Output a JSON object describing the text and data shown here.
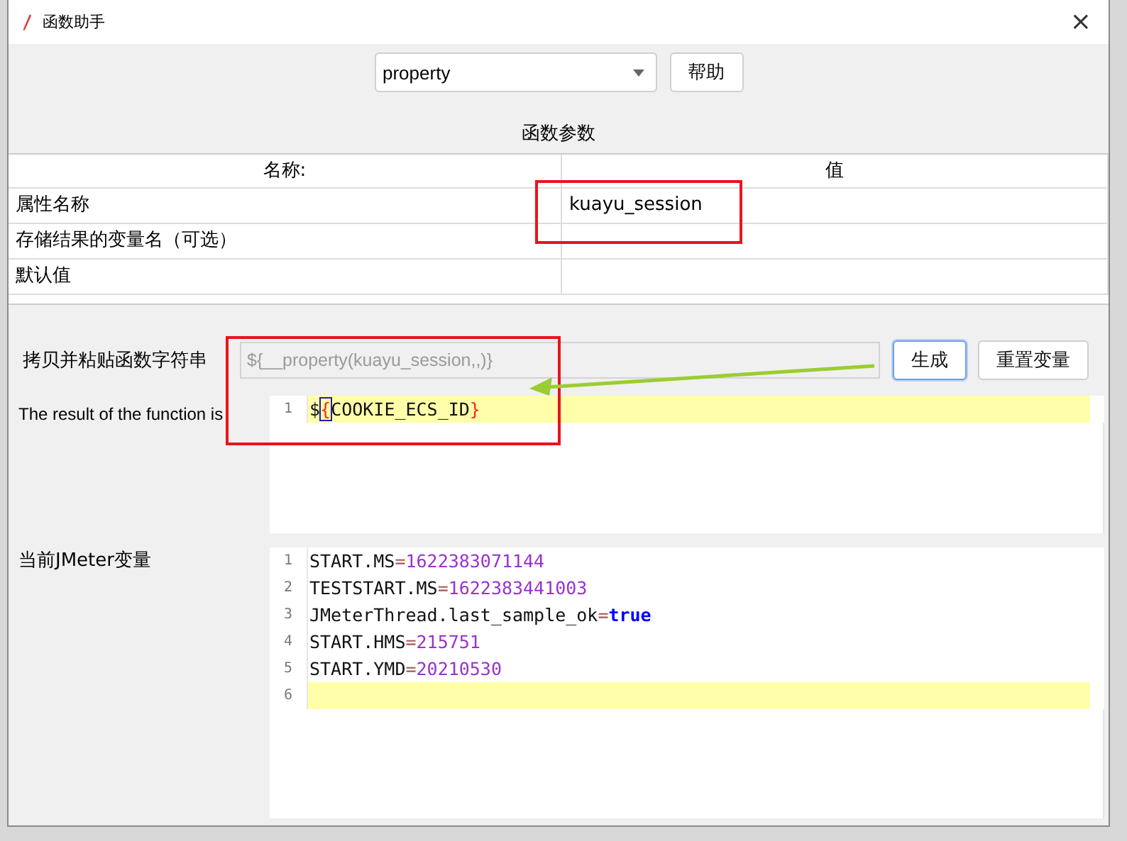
{
  "window": {
    "title": "函数助手",
    "close": "×"
  },
  "function_select": {
    "value": "property"
  },
  "help_button": "帮助",
  "section_title": "函数参数",
  "table": {
    "columns": [
      "名称:",
      "值"
    ],
    "rows": [
      {
        "name": "属性名称",
        "value": "kuayu_session"
      },
      {
        "name": "存储结果的变量名（可选）",
        "value": ""
      },
      {
        "name": "默认值",
        "value": ""
      }
    ]
  },
  "function_string": {
    "label": "拷贝并粘贴函数字符串",
    "value": "${__property(kuayu_session,,)}"
  },
  "buttons": [
    {
      "label": "生成",
      "focused": true
    },
    {
      "label": "重置变量",
      "focused": false
    }
  ],
  "result": {
    "label": "The result of the function is",
    "lines": [
      {
        "number": "1",
        "current": true,
        "tokens": [
          {
            "kind": "plain",
            "text": "$"
          },
          {
            "kind": "matched-brace",
            "text": "{"
          },
          {
            "kind": "plain",
            "text": "COOKIE_ECS_ID"
          },
          {
            "kind": "brace",
            "text": "}"
          }
        ]
      }
    ]
  },
  "variables": {
    "label": "当前JMeter变量",
    "lines": [
      {
        "number": "1",
        "current": false,
        "tokens": [
          {
            "kind": "plain",
            "text": "START.MS"
          },
          {
            "kind": "operator",
            "text": "="
          },
          {
            "kind": "number",
            "text": "1622383071144"
          }
        ]
      },
      {
        "number": "2",
        "current": false,
        "tokens": [
          {
            "kind": "plain",
            "text": "TESTSTART.MS"
          },
          {
            "kind": "operator",
            "text": "="
          },
          {
            "kind": "number",
            "text": "1622383441003"
          }
        ]
      },
      {
        "number": "3",
        "current": false,
        "tokens": [
          {
            "kind": "plain",
            "text": "JMeterThread.last_sample_ok"
          },
          {
            "kind": "operator",
            "text": "="
          },
          {
            "kind": "keyword",
            "text": "true"
          }
        ]
      },
      {
        "number": "4",
        "current": false,
        "tokens": [
          {
            "kind": "plain",
            "text": "START.HMS"
          },
          {
            "kind": "operator",
            "text": "="
          },
          {
            "kind": "number",
            "text": "215751"
          }
        ]
      },
      {
        "number": "5",
        "current": false,
        "tokens": [
          {
            "kind": "plain",
            "text": "START.YMD"
          },
          {
            "kind": "operator",
            "text": "="
          },
          {
            "kind": "number",
            "text": "20210530"
          }
        ]
      },
      {
        "number": "6",
        "current": true
      }
    ]
  }
}
